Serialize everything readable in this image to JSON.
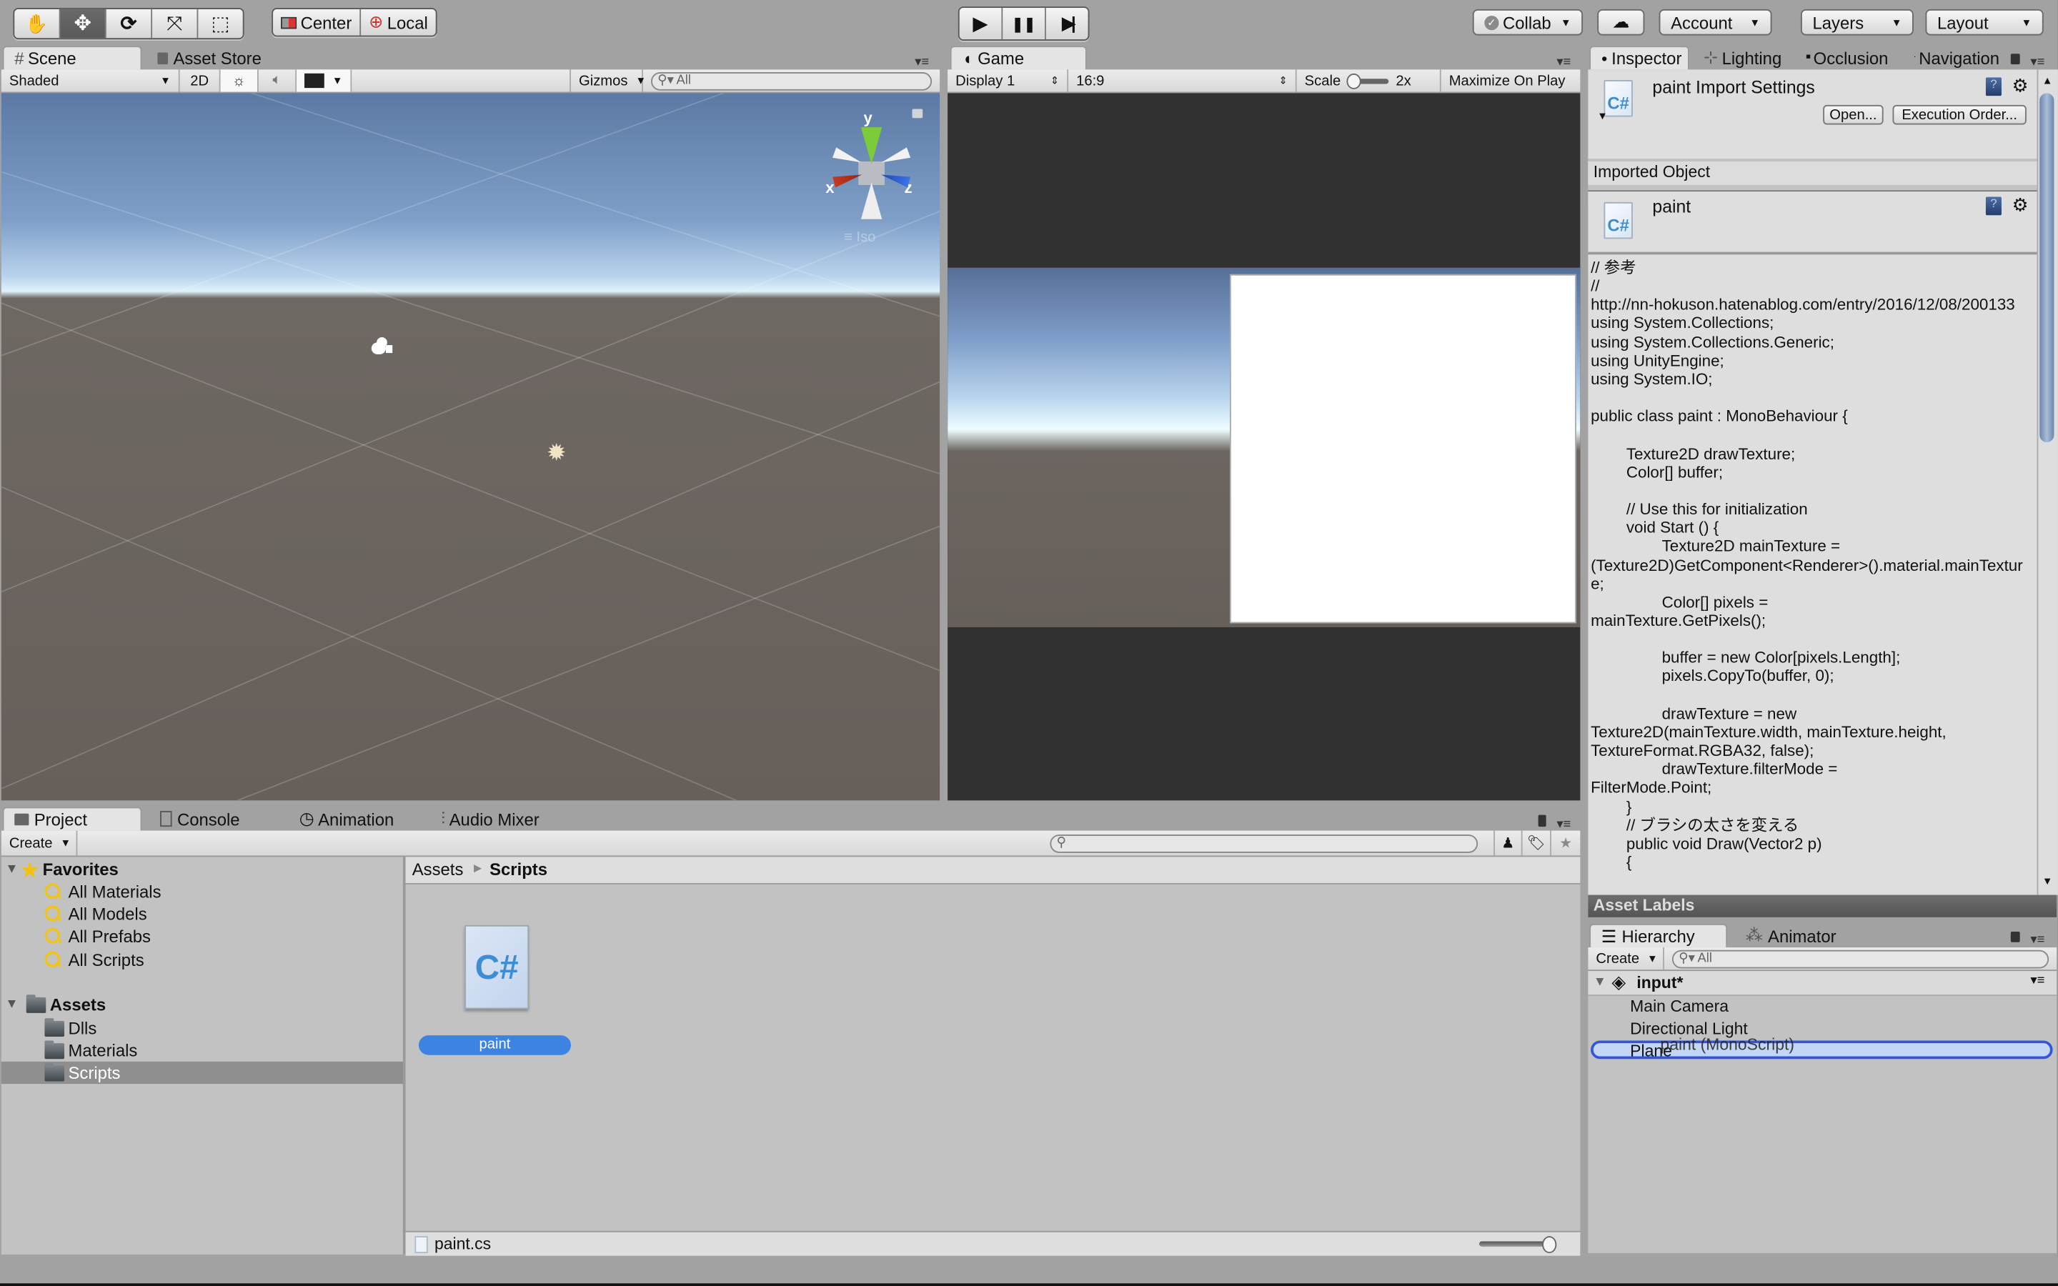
{
  "toolbar": {
    "transform_tools": [
      {
        "name": "hand-tool",
        "icon": "✋"
      },
      {
        "name": "move-tool",
        "icon": "✥",
        "active": true
      },
      {
        "name": "rotate-tool",
        "icon": "⟳"
      },
      {
        "name": "scale-tool",
        "icon": "⤧"
      },
      {
        "name": "rect-tool",
        "icon": "⬚"
      }
    ],
    "pivot_label": "Center",
    "space_label": "Local",
    "play_icon": "▶",
    "pause_icon": "❚❚",
    "step_icon": "▶|",
    "collab_label": "Collab",
    "cloud_icon": "☁",
    "account_label": "Account",
    "layers_label": "Layers",
    "layout_label": "Layout"
  },
  "scene_panel": {
    "tabs": [
      {
        "label": "Scene",
        "icon": "#"
      },
      {
        "label": "Asset Store",
        "icon": "🛍"
      }
    ],
    "shading_mode": "Shaded",
    "mode_2d": "2D",
    "gizmos_label": "Gizmos",
    "search_placeholder": "All",
    "axes": {
      "x": "x",
      "y": "y",
      "z": "z"
    },
    "projection_label": "Iso"
  },
  "game_panel": {
    "tab_label": "Game",
    "display": "Display 1",
    "aspect": "16:9",
    "scale_label": "Scale",
    "scale_value": "2x",
    "maximize_label": "Maximize On Play"
  },
  "inspector_panel": {
    "tabs": [
      {
        "label": "Inspector"
      },
      {
        "label": "Lighting"
      },
      {
        "label": "Occlusion"
      },
      {
        "label": "Navigation"
      }
    ],
    "title": "paint Import Settings",
    "open_button": "Open...",
    "execution_order_button": "Execution Order...",
    "section_header": "Imported Object",
    "object_name": "paint",
    "code": "// 参考\n//\nhttp://nn-hokuson.hatenablog.com/entry/2016/12/08/200133\nusing System.Collections;\nusing System.Collections.Generic;\nusing UnityEngine;\nusing System.IO;\n\npublic class paint : MonoBehaviour {\n\n\t\tTexture2D drawTexture;\n\t\tColor[] buffer;\n\n\t\t// Use this for initialization\n\t\tvoid Start () {\n\t\t\t\tTexture2D mainTexture =\n(Texture2D)GetComponent<Renderer>().material.mainTexture;\n\t\t\t\tColor[] pixels =\nmainTexture.GetPixels();\n\n\t\t\t\tbuffer = new Color[pixels.Length];\n\t\t\t\tpixels.CopyTo(buffer, 0);\n\n\t\t\t\tdrawTexture = new\nTexture2D(mainTexture.width, mainTexture.height,\nTextureFormat.RGBA32, false);\n\t\t\t\tdrawTexture.filterMode =\nFilterMode.Point;\n\t\t}\n\t\t// ブラシの太さを変える\n\t\tpublic void Draw(Vector2 p)\n\t\t{",
    "asset_labels": "Asset Labels"
  },
  "project_panel": {
    "tabs": [
      {
        "label": "Project"
      },
      {
        "label": "Console"
      },
      {
        "label": "Animation"
      },
      {
        "label": "Audio Mixer"
      }
    ],
    "create_label": "Create",
    "favorites_label": "Favorites",
    "favorites": [
      "All Materials",
      "All Models",
      "All Prefabs",
      "All Scripts"
    ],
    "assets_label": "Assets",
    "folders": [
      "Dlls",
      "Materials",
      "Scripts"
    ],
    "selected_folder": "Scripts",
    "breadcrumb": [
      "Assets",
      "Scripts"
    ],
    "asset_item": "paint",
    "status_file": "paint.cs"
  },
  "hierarchy_panel": {
    "tabs": [
      {
        "label": "Hierarchy"
      },
      {
        "label": "Animator"
      }
    ],
    "create_label": "Create",
    "search_placeholder": "All",
    "scene_name": "input*",
    "items": [
      "Main Camera",
      "Directional Light",
      "Plane"
    ],
    "drag_label": "paint (MonoScript)"
  }
}
